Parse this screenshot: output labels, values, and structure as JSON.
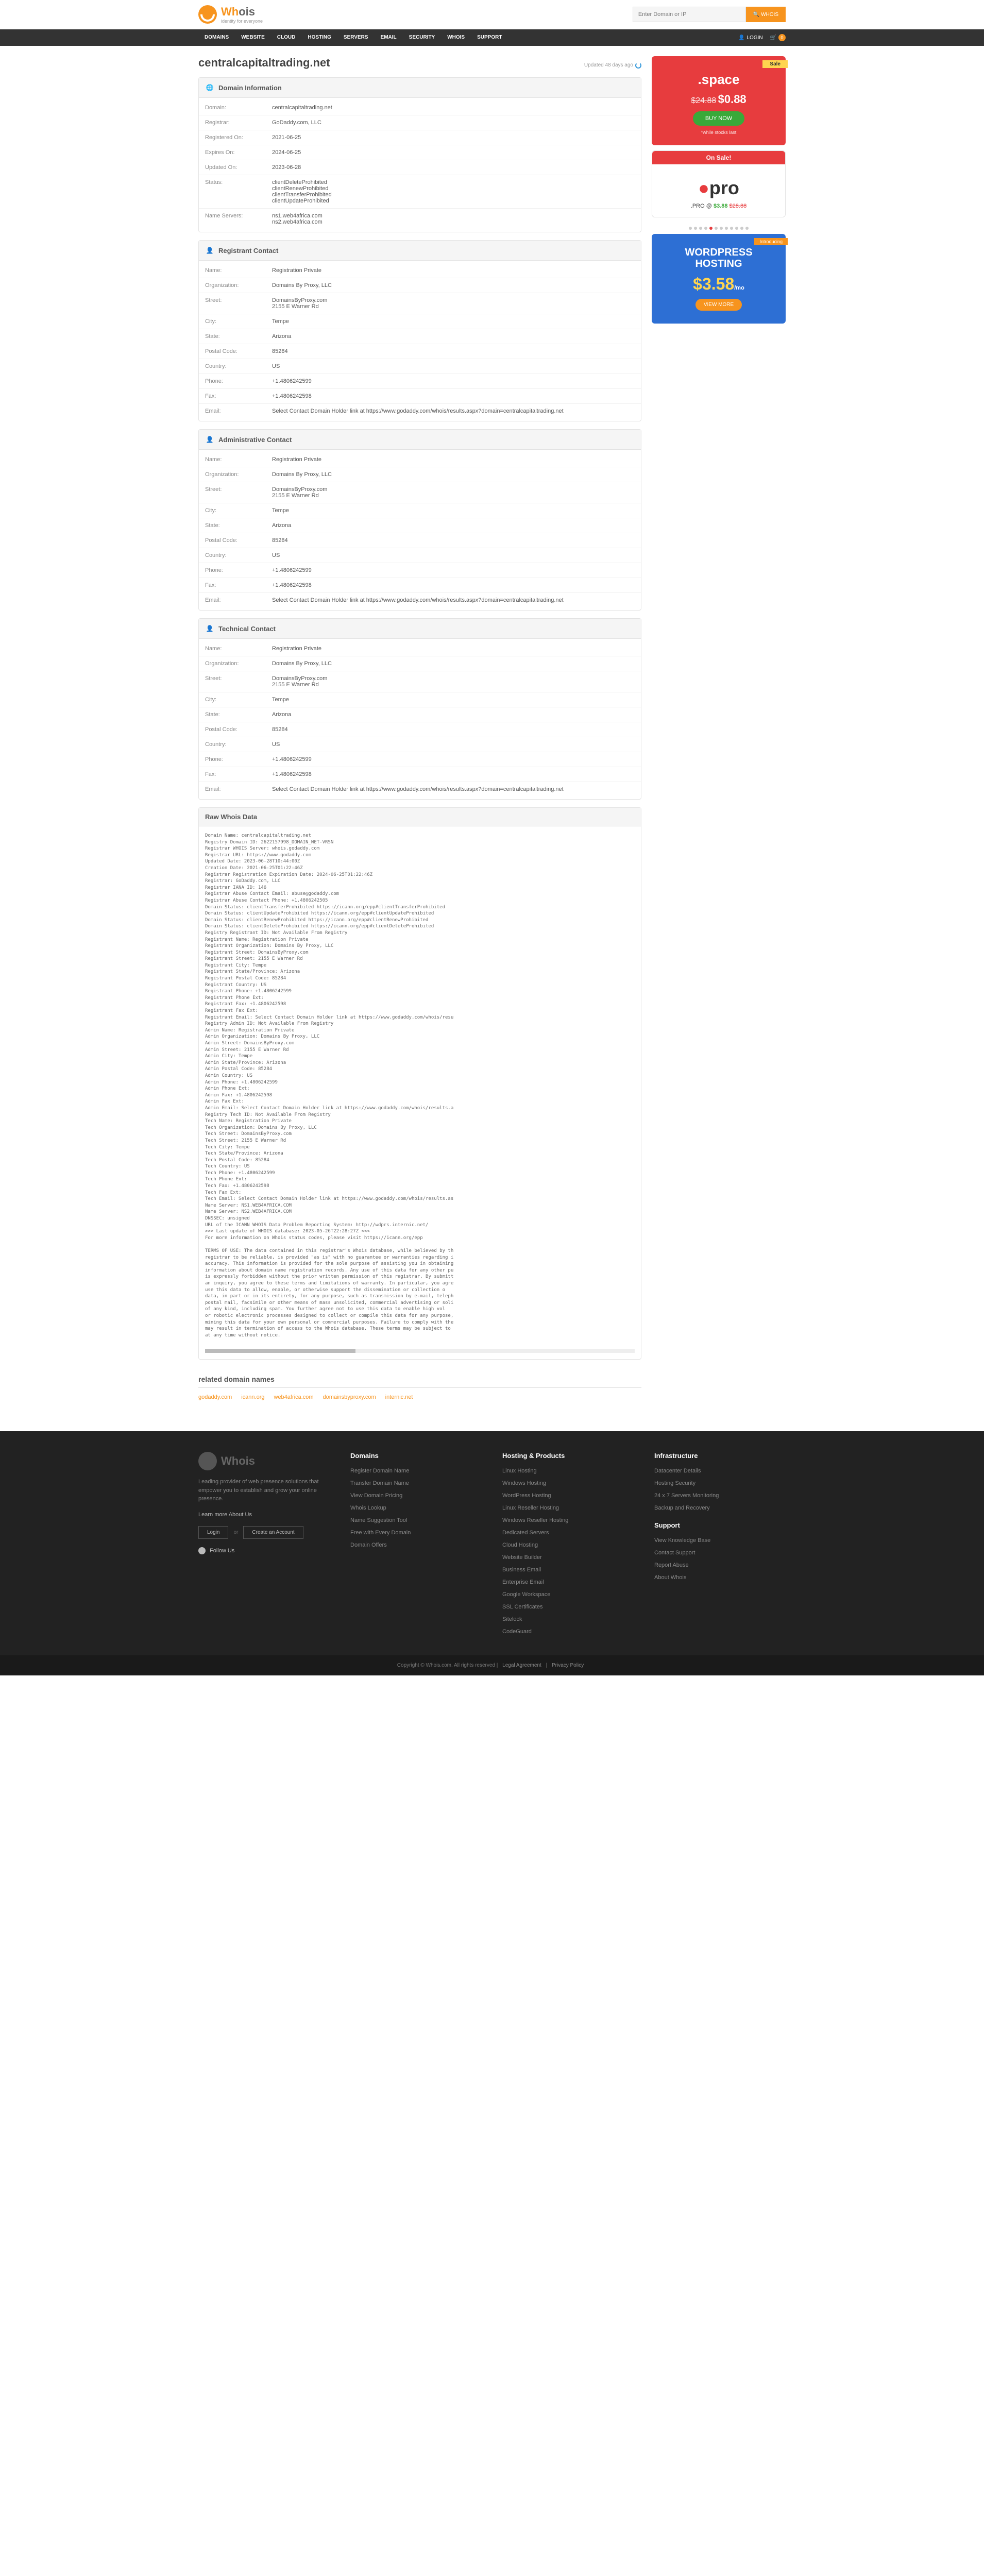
{
  "brand": {
    "name_pre": "Wh",
    "name_post": "ois",
    "tagline": "identity for everyone"
  },
  "search": {
    "placeholder": "Enter Domain or IP",
    "button": "🔍 WHOIS"
  },
  "nav": [
    "DOMAINS",
    "WEBSITE",
    "CLOUD",
    "HOSTING",
    "SERVERS",
    "EMAIL",
    "SECURITY",
    "WHOIS",
    "SUPPORT"
  ],
  "login": "LOGIN",
  "cart_count": "0",
  "page_title": "centralcapitaltrading.net",
  "updated": "Updated 48 days ago",
  "sections": {
    "domain_info": {
      "title": "Domain Information",
      "rows": [
        {
          "l": "Domain:",
          "v": "centralcapitaltrading.net"
        },
        {
          "l": "Registrar:",
          "v": "GoDaddy.com, LLC"
        },
        {
          "l": "Registered On:",
          "v": "2021-06-25"
        },
        {
          "l": "Expires On:",
          "v": "2024-06-25"
        },
        {
          "l": "Updated On:",
          "v": "2023-06-28"
        },
        {
          "l": "Status:",
          "v": "clientDeleteProhibited\nclientRenewProhibited\nclientTransferProhibited\nclientUpdateProhibited"
        },
        {
          "l": "Name Servers:",
          "v": "ns1.web4africa.com\nns2.web4africa.com"
        }
      ]
    },
    "registrant": {
      "title": "Registrant Contact",
      "rows": [
        {
          "l": "Name:",
          "v": "Registration Private"
        },
        {
          "l": "Organization:",
          "v": "Domains By Proxy, LLC"
        },
        {
          "l": "Street:",
          "v": "DomainsByProxy.com\n2155 E Warner Rd"
        },
        {
          "l": "City:",
          "v": "Tempe"
        },
        {
          "l": "State:",
          "v": "Arizona"
        },
        {
          "l": "Postal Code:",
          "v": "85284"
        },
        {
          "l": "Country:",
          "v": "US"
        },
        {
          "l": "Phone:",
          "v": "+1.4806242599"
        },
        {
          "l": "Fax:",
          "v": "+1.4806242598"
        },
        {
          "l": "Email:",
          "v": "Select Contact Domain Holder link at https://www.godaddy.com/whois/results.aspx?domain=centralcapitaltrading.net"
        }
      ]
    },
    "admin": {
      "title": "Administrative Contact",
      "rows": [
        {
          "l": "Name:",
          "v": "Registration Private"
        },
        {
          "l": "Organization:",
          "v": "Domains By Proxy, LLC"
        },
        {
          "l": "Street:",
          "v": "DomainsByProxy.com\n2155 E Warner Rd"
        },
        {
          "l": "City:",
          "v": "Tempe"
        },
        {
          "l": "State:",
          "v": "Arizona"
        },
        {
          "l": "Postal Code:",
          "v": "85284"
        },
        {
          "l": "Country:",
          "v": "US"
        },
        {
          "l": "Phone:",
          "v": "+1.4806242599"
        },
        {
          "l": "Fax:",
          "v": "+1.4806242598"
        },
        {
          "l": "Email:",
          "v": "Select Contact Domain Holder link at https://www.godaddy.com/whois/results.aspx?domain=centralcapitaltrading.net"
        }
      ]
    },
    "tech": {
      "title": "Technical Contact",
      "rows": [
        {
          "l": "Name:",
          "v": "Registration Private"
        },
        {
          "l": "Organization:",
          "v": "Domains By Proxy, LLC"
        },
        {
          "l": "Street:",
          "v": "DomainsByProxy.com\n2155 E Warner Rd"
        },
        {
          "l": "City:",
          "v": "Tempe"
        },
        {
          "l": "State:",
          "v": "Arizona"
        },
        {
          "l": "Postal Code:",
          "v": "85284"
        },
        {
          "l": "Country:",
          "v": "US"
        },
        {
          "l": "Phone:",
          "v": "+1.4806242599"
        },
        {
          "l": "Fax:",
          "v": "+1.4806242598"
        },
        {
          "l": "Email:",
          "v": "Select Contact Domain Holder link at https://www.godaddy.com/whois/results.aspx?domain=centralcapitaltrading.net"
        }
      ]
    },
    "raw": {
      "title": "Raw Whois Data",
      "text": "Domain Name: centralcapitaltrading.net\nRegistry Domain ID: 2622157998_DOMAIN_NET-VRSN\nRegistrar WHOIS Server: whois.godaddy.com\nRegistrar URL: https://www.godaddy.com\nUpdated Date: 2023-06-28T10:44:00Z\nCreation Date: 2021-06-25T01:22:46Z\nRegistrar Registration Expiration Date: 2024-06-25T01:22:46Z\nRegistrar: GoDaddy.com, LLC\nRegistrar IANA ID: 146\nRegistrar Abuse Contact Email: abuse@godaddy.com\nRegistrar Abuse Contact Phone: +1.4806242505\nDomain Status: clientTransferProhibited https://icann.org/epp#clientTransferProhibited\nDomain Status: clientUpdateProhibited https://icann.org/epp#clientUpdateProhibited\nDomain Status: clientRenewProhibited https://icann.org/epp#clientRenewProhibited\nDomain Status: clientDeleteProhibited https://icann.org/epp#clientDeleteProhibited\nRegistry Registrant ID: Not Available From Registry\nRegistrant Name: Registration Private\nRegistrant Organization: Domains By Proxy, LLC\nRegistrant Street: DomainsByProxy.com\nRegistrant Street: 2155 E Warner Rd\nRegistrant City: Tempe\nRegistrant State/Province: Arizona\nRegistrant Postal Code: 85284\nRegistrant Country: US\nRegistrant Phone: +1.4806242599\nRegistrant Phone Ext:\nRegistrant Fax: +1.4806242598\nRegistrant Fax Ext:\nRegistrant Email: Select Contact Domain Holder link at https://www.godaddy.com/whois/resu\nRegistry Admin ID: Not Available From Registry\nAdmin Name: Registration Private\nAdmin Organization: Domains By Proxy, LLC\nAdmin Street: DomainsByProxy.com\nAdmin Street: 2155 E Warner Rd\nAdmin City: Tempe\nAdmin State/Province: Arizona\nAdmin Postal Code: 85284\nAdmin Country: US\nAdmin Phone: +1.4806242599\nAdmin Phone Ext:\nAdmin Fax: +1.4806242598\nAdmin Fax Ext:\nAdmin Email: Select Contact Domain Holder link at https://www.godaddy.com/whois/results.a\nRegistry Tech ID: Not Available From Registry\nTech Name: Registration Private\nTech Organization: Domains By Proxy, LLC\nTech Street: DomainsByProxy.com\nTech Street: 2155 E Warner Rd\nTech City: Tempe\nTech State/Province: Arizona\nTech Postal Code: 85284\nTech Country: US\nTech Phone: +1.4806242599\nTech Phone Ext:\nTech Fax: +1.4806242598\nTech Fax Ext:\nTech Email: Select Contact Domain Holder link at https://www.godaddy.com/whois/results.as\nName Server: NS1.WEB4AFRICA.COM\nName Server: NS2.WEB4AFRICA.COM\nDNSSEC: unsigned\nURL of the ICANN WHOIS Data Problem Reporting System: http://wdprs.internic.net/\n>>> Last update of WHOIS database: 2023-05-26T22:28:27Z <<<\nFor more information on Whois status codes, please visit https://icann.org/epp\n\nTERMS OF USE: The data contained in this registrar's Whois database, while believed by th\nregistrar to be reliable, is provided \"as is\" with no guarantee or warranties regarding i\naccuracy. This information is provided for the sole purpose of assisting you in obtaining\ninformation about domain name registration records. Any use of this data for any other pu\nis expressly forbidden without the prior written permission of this registrar. By submitt\nan inquiry, you agree to these terms and limitations of warranty. In particular, you agre\nuse this data to allow, enable, or otherwise support the dissemination or collection o\ndata, in part or in its entirety, for any purpose, such as transmission by e-mail, teleph\npostal mail, facsimile or other means of mass unsolicited, commercial advertising or soli\nof any kind, including spam. You further agree not to use this data to enable high vol\nor robotic electronic processes designed to collect or compile this data for any purpose,\nmining this data for your own personal or commercial purposes. Failure to comply with the\nmay result in termination of access to the Whois database. These terms may be subject to\nat any time without notice."
    }
  },
  "promo1": {
    "sale": "Sale",
    "title": ".space",
    "old": "$24.88",
    "new": "$0.88",
    "buy": "BUY NOW",
    "small": "*while stocks last"
  },
  "promo2": {
    "onsale": "On Sale!",
    "dot": "●",
    "text": "pro",
    "label": ".PRO @",
    "price": "$3.88",
    "old": "$28.88"
  },
  "promo3": {
    "tag": "Introducing",
    "title1": "WORDPRESS",
    "title2": "HOSTING",
    "price": "$3.58",
    "per": "/mo",
    "btn": "VIEW MORE"
  },
  "related": {
    "title": "related domain names",
    "links": [
      "godaddy.com",
      "icann.org",
      "web4africa.com",
      "domainsbyproxy.com",
      "internic.net"
    ]
  },
  "footer": {
    "desc": "Leading provider of web presence solutions that empower you to establish and grow your online presence.",
    "about": "Learn more About Us",
    "login": "Login",
    "or": "or",
    "create": "Create an Account",
    "follow": "Follow Us",
    "cols": [
      {
        "h": "Domains",
        "links": [
          "Register Domain Name",
          "Transfer Domain Name",
          "View Domain Pricing",
          "Whois Lookup",
          "Name Suggestion Tool",
          "Free with Every Domain",
          "Domain Offers"
        ]
      },
      {
        "h": "Hosting & Products",
        "links": [
          "Linux Hosting",
          "Windows Hosting",
          "WordPress Hosting",
          "Linux Reseller Hosting",
          "Windows Reseller Hosting",
          "Dedicated Servers",
          "Cloud Hosting",
          "Website Builder",
          "Business Email",
          "Enterprise Email",
          "Google Workspace",
          "SSL Certificates",
          "Sitelock",
          "CodeGuard"
        ]
      },
      {
        "h": "Infrastructure",
        "links": [
          "Datacenter Details",
          "Hosting Security",
          "24 x 7 Servers Monitoring",
          "Backup and Recovery"
        ],
        "h2": "Support",
        "links2": [
          "View Knowledge Base",
          "Contact Support",
          "Report Abuse",
          "About Whois"
        ]
      }
    ],
    "copyright": "Copyright © Whois.com. All rights reserved",
    "legal": "Legal Agreement",
    "privacy": "Privacy Policy"
  }
}
